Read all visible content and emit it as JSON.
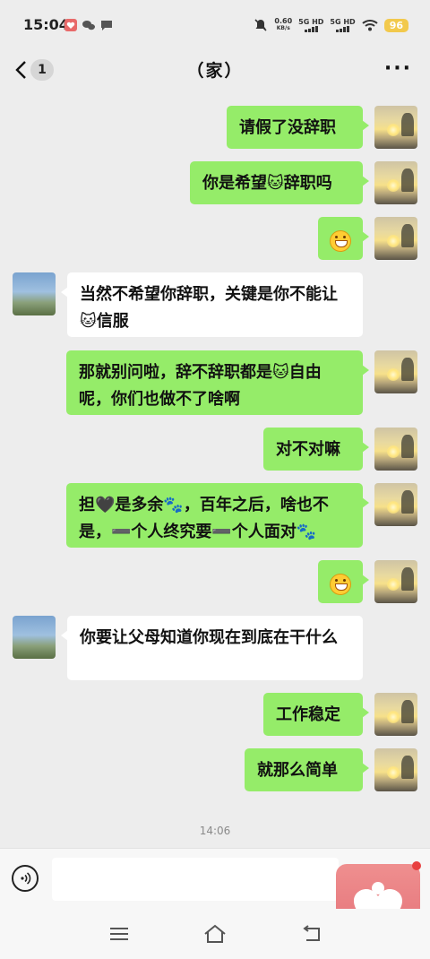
{
  "status_bar": {
    "time": "15:04",
    "net_speed_value": "0.60",
    "net_speed_unit": "KB/s",
    "sim1": "5G HD",
    "sim2": "5G HD",
    "battery": "96",
    "icons": [
      "photo-app-icon",
      "wechat-icon",
      "message-icon",
      "mute-icon",
      "signal-icon",
      "wifi-icon",
      "battery-icon"
    ]
  },
  "header": {
    "back_count": "1",
    "title": "（家）",
    "more_label": "···"
  },
  "messages": [
    {
      "side": "me",
      "text": "请假了没辞职"
    },
    {
      "side": "me",
      "text": "你是希望🐱辞职吗"
    },
    {
      "side": "me",
      "text": "",
      "emoji": "grin-emoji"
    },
    {
      "side": "other",
      "text": "当然不希望你辞职，关键是你不能让🐱信服"
    },
    {
      "side": "me",
      "text": "那就别问啦，辞不辞职都是🐱自由呢，你们也做不了啥啊"
    },
    {
      "side": "me",
      "text": "对不对嘛"
    },
    {
      "side": "me",
      "text": "担🖤是多余🐾，百年之后，啥也不是，➖个人终究要➖个人面对🐾"
    },
    {
      "side": "me",
      "text": "",
      "emoji": "grin-emoji"
    },
    {
      "side": "other",
      "text": "你要让父母知道你现在到底在干什么"
    },
    {
      "side": "me",
      "text": "工作稳定"
    },
    {
      "side": "me",
      "text": "就那么简单"
    }
  ],
  "timestamp": "14:06",
  "input": {
    "value": "",
    "placeholder": ""
  },
  "colors": {
    "my_bubble": "#95ec69",
    "other_bubble": "#ffffff",
    "background": "#ededed"
  }
}
